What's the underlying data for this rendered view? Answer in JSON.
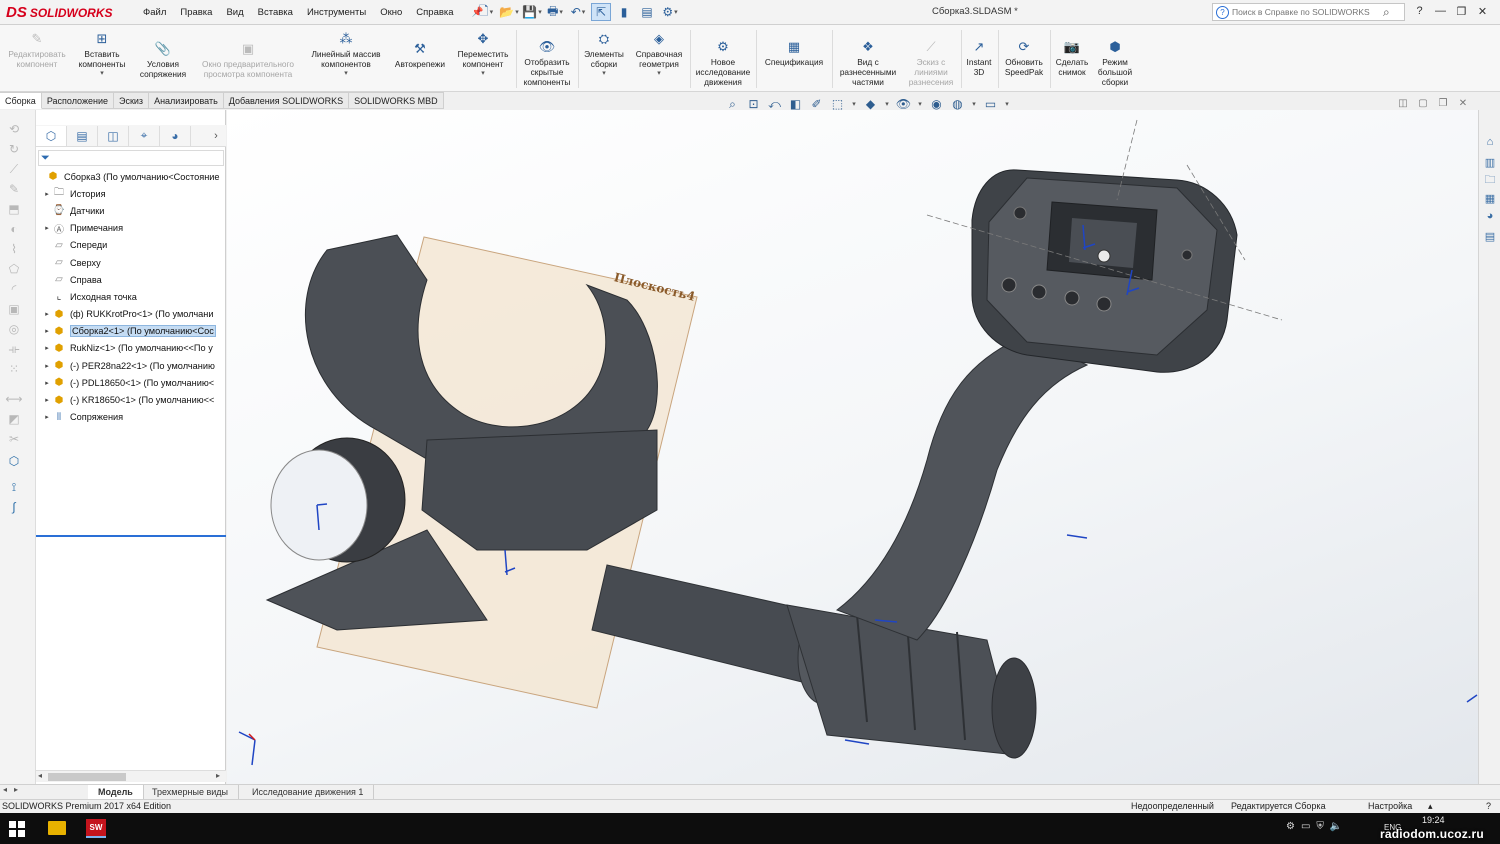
{
  "app": {
    "logo": "SOLIDWORKS",
    "logo_mark": "DS",
    "document_title": "Сборка3.SLDASM *"
  },
  "menu": [
    "Файл",
    "Правка",
    "Вид",
    "Вставка",
    "Инструменты",
    "Окно",
    "Справка"
  ],
  "help_search": {
    "placeholder": "Поиск в Справке по SOLIDWORKS"
  },
  "ribbon": {
    "edit_component": "Редактировать компонент",
    "insert_components": "Вставить компоненты",
    "mate": "Условия сопряжения",
    "component_preview": "Окно предварительного просмотра компонента",
    "linear_pattern": "Линейный массив компонентов",
    "smart_fasteners": "Автокрепежи",
    "move_component": "Переместить компонент",
    "show_hidden": "Отобразить скрытые компоненты",
    "assembly_features": "Элементы сборки",
    "reference_geometry": "Справочная геометрия",
    "new_motion_study": "Новое исследование движения",
    "bom": "Спецификация",
    "exploded_view": "Вид с разнесенными частями",
    "explode_line_sketch": "Эскиз с линиями разнесения",
    "instant3d": "Instant 3D",
    "update_speedpak": "Обновить SpeedPak",
    "take_snapshot": "Сделать снимок",
    "large_assembly": "Режим большой сборки"
  },
  "command_tabs": [
    "Сборка",
    "Расположение",
    "Эскиз",
    "Анализировать",
    "Добавления SOLIDWORKS",
    "SOLIDWORKS MBD"
  ],
  "tree": [
    {
      "label": "Сборка3  (По умолчанию<Состояние",
      "icon": "assembly-icon",
      "expand": ""
    },
    {
      "label": "История",
      "icon": "history-icon",
      "expand": "▸"
    },
    {
      "label": "Датчики",
      "icon": "sensor-icon",
      "expand": ""
    },
    {
      "label": "Примечания",
      "icon": "annotation-icon",
      "expand": "▸"
    },
    {
      "label": "Спереди",
      "icon": "plane-icon",
      "expand": ""
    },
    {
      "label": "Сверху",
      "icon": "plane-icon",
      "expand": ""
    },
    {
      "label": "Справа",
      "icon": "plane-icon",
      "expand": ""
    },
    {
      "label": "Исходная точка",
      "icon": "origin-icon",
      "expand": ""
    },
    {
      "label": "(ф) RUKKrotPro<1> (По умолчани",
      "icon": "part-icon",
      "expand": "▸"
    },
    {
      "label": "Сборка2<1> (По умолчанию<Сос",
      "icon": "subassembly-icon",
      "expand": "▸",
      "selected": true
    },
    {
      "label": "RukNiz<1> (По умолчанию<<По у",
      "icon": "part-icon",
      "expand": "▸"
    },
    {
      "label": "(-) PER28na22<1> (По умолчанию",
      "icon": "part-icon",
      "expand": "▸"
    },
    {
      "label": "(-) PDL18650<1> (По умолчанию<",
      "icon": "part-icon",
      "expand": "▸"
    },
    {
      "label": "(-) KR18650<1> (По умолчанию<<",
      "icon": "part-icon",
      "expand": "▸"
    },
    {
      "label": "Сопряжения",
      "icon": "mates-icon",
      "expand": "▸"
    }
  ],
  "viewport": {
    "plane_label": "Плоскость4"
  },
  "bottom_tabs": [
    "Модель",
    "Трехмерные виды",
    "Исследование движения 1"
  ],
  "status": {
    "edition": "SOLIDWORKS Premium 2017 x64 Edition",
    "definition": "Недоопределенный",
    "editing": "Редактируется Сборка",
    "custom": "Настройка"
  },
  "taskbar": {
    "sw_label": "SW",
    "lang": "ENG",
    "time": "19:24",
    "watermark": "radiodom.ucoz.ru"
  },
  "colors": {
    "brand": "#d6001c",
    "selection": "#c5dcf3",
    "model": "#4d5157",
    "plane": "#f3e6d4"
  }
}
